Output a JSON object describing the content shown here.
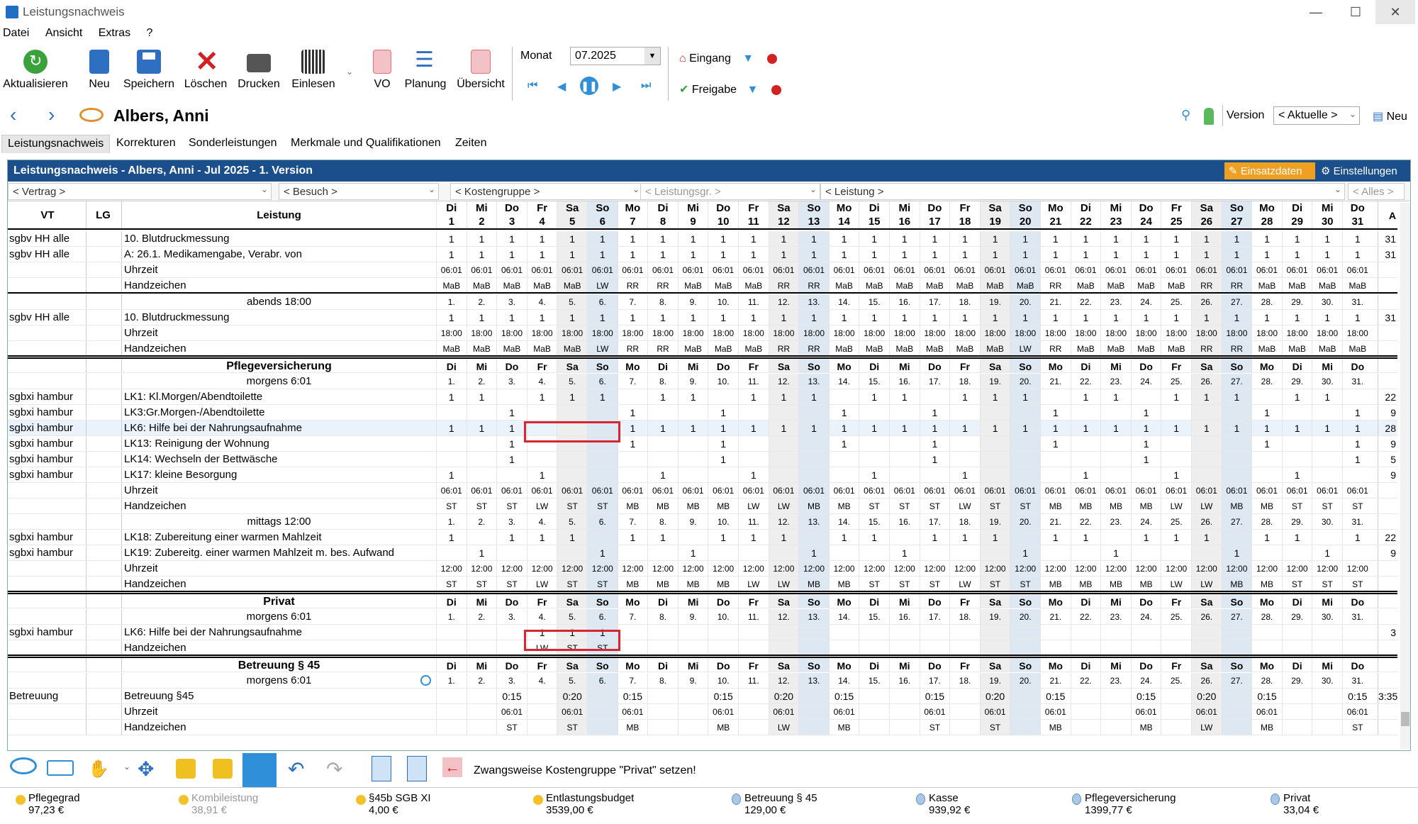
{
  "window": {
    "title": "Leistungsnachweis",
    "controls": [
      "—",
      "☐",
      "✕"
    ]
  },
  "menu": [
    "Datei",
    "Ansicht",
    "Extras",
    "?"
  ],
  "toolbar": {
    "buttons": [
      {
        "label": "Aktualisieren",
        "icon": "refresh-icon",
        "color": "#3aa23a"
      },
      {
        "label": "Neu",
        "icon": "new-document-icon",
        "color": "#2f6fc1"
      },
      {
        "label": "Speichern",
        "icon": "save-icon",
        "color": "#2f6fc1"
      },
      {
        "label": "Löschen",
        "icon": "delete-icon",
        "color": "#d32020"
      },
      {
        "label": "Drucken",
        "icon": "print-icon",
        "color": "#444444"
      },
      {
        "label": "Einlesen",
        "icon": "barcode-icon",
        "color": "#333333"
      },
      {
        "label": "VO",
        "icon": "prescription-icon",
        "color": "#e0707a"
      },
      {
        "label": "Planung",
        "icon": "planning-list-icon",
        "color": "#2f6fc1"
      },
      {
        "label": "Übersicht",
        "icon": "overview-icon",
        "color": "#e0707a"
      }
    ],
    "monat_label": "Monat",
    "monat_value": "07.2025",
    "eingang_label": "Eingang",
    "freigabe_label": "Freigabe"
  },
  "nav": {
    "patient_name": "Albers, Anni",
    "version_label": "Version",
    "version_value": "< Aktuelle >",
    "neu_label": "Neu"
  },
  "tabs": [
    "Leistungsnachweis",
    "Korrekturen",
    "Sonderleistungen",
    "Merkmale und Qualifikationen",
    "Zeiten"
  ],
  "panel": {
    "title": "Leistungsnachweis - Albers, Anni - Jul 2025 - 1. Version",
    "einsatzdaten": "Einsatzdaten",
    "einstellungen": "Einstellungen"
  },
  "filters": [
    "< Vertrag >",
    "< Besuch >",
    "< Kostengruppe >",
    "< Leistungsgr. >",
    "< Leistung >",
    "< Alles >"
  ],
  "header": {
    "vt": "VT",
    "lg": "LG",
    "leistung": "Leistung",
    "a": "A",
    "weekdays": [
      "Di",
      "Mi",
      "Do",
      "Fr",
      "Sa",
      "So",
      "Mo",
      "Di",
      "Mi",
      "Do",
      "Fr",
      "Sa",
      "So",
      "Mo",
      "Di",
      "Mi",
      "Do",
      "Fr",
      "Sa",
      "So",
      "Mo",
      "Di",
      "Mi",
      "Do",
      "Fr",
      "Sa",
      "So",
      "Mo",
      "Di",
      "Mi",
      "Do"
    ],
    "days": [
      "1",
      "2",
      "3",
      "4",
      "5",
      "6",
      "7",
      "8",
      "9",
      "10",
      "11",
      "12",
      "13",
      "14",
      "15",
      "16",
      "17",
      "18",
      "19",
      "20",
      "21",
      "22",
      "23",
      "24",
      "25",
      "26",
      "27",
      "28",
      "29",
      "30",
      "31"
    ]
  },
  "rows": [
    {
      "vt": "sgbv HH alle",
      "ls": "10. Blutdruckmessung",
      "d": [
        "1",
        "1",
        "1",
        "1",
        "1",
        "1",
        "1",
        "1",
        "1",
        "1",
        "1",
        "1",
        "1",
        "1",
        "1",
        "1",
        "1",
        "1",
        "1",
        "1",
        "1",
        "1",
        "1",
        "1",
        "1",
        "1",
        "1",
        "1",
        "1",
        "1",
        "1"
      ],
      "a": "31"
    },
    {
      "vt": "sgbv HH alle",
      "ls": "A: 26.1. Medikamengabe, Verabr. von",
      "d": [
        "1",
        "1",
        "1",
        "1",
        "1",
        "1",
        "1",
        "1",
        "1",
        "1",
        "1",
        "1",
        "1",
        "1",
        "1",
        "1",
        "1",
        "1",
        "1",
        "1",
        "1",
        "1",
        "1",
        "1",
        "1",
        "1",
        "1",
        "1",
        "1",
        "1",
        "1"
      ],
      "a": "31"
    },
    {
      "ls": "Uhrzeit",
      "sz": "small",
      "d": [
        "06:01",
        "06:01",
        "06:01",
        "06:01",
        "06:01",
        "06:01",
        "06:01",
        "06:01",
        "06:01",
        "06:01",
        "06:01",
        "06:01",
        "06:01",
        "06:01",
        "06:01",
        "06:01",
        "06:01",
        "06:01",
        "06:01",
        "06:01",
        "06:01",
        "06:01",
        "06:01",
        "06:01",
        "06:01",
        "06:01",
        "06:01",
        "06:01",
        "06:01",
        "06:01",
        "06:01"
      ]
    },
    {
      "ls": "Handzeichen",
      "sz": "small",
      "thick": true,
      "d": [
        "MaB",
        "MaB",
        "MaB",
        "MaB",
        "MaB",
        "LW",
        "RR",
        "RR",
        "MaB",
        "MaB",
        "MaB",
        "RR",
        "RR",
        "MaB",
        "MaB",
        "MaB",
        "MaB",
        "MaB",
        "MaB",
        "MaB",
        "RR",
        "MaB",
        "MaB",
        "MaB",
        "MaB",
        "RR",
        "RR",
        "MaB",
        "MaB",
        "MaB",
        "MaB"
      ]
    },
    {
      "ls": "abends 18:00",
      "ctr": true,
      "sz": "small",
      "d": [
        "1.",
        "2.",
        "3.",
        "4.",
        "5.",
        "6.",
        "7.",
        "8.",
        "9.",
        "10.",
        "11.",
        "12.",
        "13.",
        "14.",
        "15.",
        "16.",
        "17.",
        "18.",
        "19.",
        "20.",
        "21.",
        "22.",
        "23.",
        "24.",
        "25.",
        "26.",
        "27.",
        "28.",
        "29.",
        "30.",
        "31."
      ]
    },
    {
      "vt": "sgbv HH alle",
      "ls": "10. Blutdruckmessung",
      "d": [
        "1",
        "1",
        "1",
        "1",
        "1",
        "1",
        "1",
        "1",
        "1",
        "1",
        "1",
        "1",
        "1",
        "1",
        "1",
        "1",
        "1",
        "1",
        "1",
        "1",
        "1",
        "1",
        "1",
        "1",
        "1",
        "1",
        "1",
        "1",
        "1",
        "1",
        "1"
      ],
      "a": "31"
    },
    {
      "ls": "Uhrzeit",
      "sz": "small",
      "d": [
        "18:00",
        "18:00",
        "18:00",
        "18:00",
        "18:00",
        "18:00",
        "18:00",
        "18:00",
        "18:00",
        "18:00",
        "18:00",
        "18:00",
        "18:00",
        "18:00",
        "18:00",
        "18:00",
        "18:00",
        "18:00",
        "18:00",
        "18:00",
        "18:00",
        "18:00",
        "18:00",
        "18:00",
        "18:00",
        "18:00",
        "18:00",
        "18:00",
        "18:00",
        "18:00",
        "18:00"
      ]
    },
    {
      "ls": "Handzeichen",
      "sz": "small",
      "thick": true,
      "d": [
        "MaB",
        "MaB",
        "MaB",
        "MaB",
        "MaB",
        "LW",
        "RR",
        "RR",
        "MaB",
        "MaB",
        "MaB",
        "RR",
        "RR",
        "MaB",
        "MaB",
        "MaB",
        "MaB",
        "MaB",
        "MaB",
        "LW",
        "RR",
        "MaB",
        "MaB",
        "MaB",
        "MaB",
        "RR",
        "RR",
        "MaB",
        "MaB",
        "MaB",
        "MaB"
      ]
    },
    {
      "ls": "Pflegeversicherung",
      "ctr": true,
      "bold": true,
      "wk": true
    },
    {
      "ls": "morgens 6:01",
      "ctr": true,
      "sz": "small",
      "d": [
        "1.",
        "2.",
        "3.",
        "4.",
        "5.",
        "6.",
        "7.",
        "8.",
        "9.",
        "10.",
        "11.",
        "12.",
        "13.",
        "14.",
        "15.",
        "16.",
        "17.",
        "18.",
        "19.",
        "20.",
        "21.",
        "22.",
        "23.",
        "24.",
        "25.",
        "26.",
        "27.",
        "28.",
        "29.",
        "30.",
        "31."
      ]
    },
    {
      "vt": "sgbxi hambur",
      "ls": "LK1: Kl.Morgen/Abendtoilette",
      "d": [
        "1",
        "1",
        "",
        "1",
        "1",
        "1",
        "",
        "1",
        "1",
        "",
        "1",
        "1",
        "1",
        "",
        "1",
        "1",
        "",
        "1",
        "1",
        "1",
        "",
        "1",
        "1",
        "",
        "1",
        "1",
        "1",
        "",
        "1",
        "1",
        ""
      ],
      "a": "22"
    },
    {
      "vt": "sgbxi hambur",
      "ls": "LK3:Gr.Morgen-/Abendtoilette",
      "d": [
        "",
        "",
        "1",
        "",
        "",
        "",
        "1",
        "",
        "",
        "1",
        "",
        "",
        "",
        "1",
        "",
        "",
        "1",
        "",
        "",
        "",
        "1",
        "",
        "",
        "1",
        "",
        "",
        "",
        "1",
        "",
        "",
        "1"
      ],
      "a": "9"
    },
    {
      "vt": "sgbxi hambur",
      "ls": "LK6: Hilfe bei der Nahrungsaufnahme",
      "sel": true,
      "d": [
        "1",
        "1",
        "1",
        "",
        "",
        "",
        "1",
        "1",
        "1",
        "1",
        "1",
        "1",
        "1",
        "1",
        "1",
        "1",
        "1",
        "1",
        "1",
        "1",
        "1",
        "1",
        "1",
        "1",
        "1",
        "1",
        "1",
        "1",
        "1",
        "1",
        "1"
      ],
      "a": "28"
    },
    {
      "vt": "sgbxi hambur",
      "ls": "LK13: Reinigung der Wohnung",
      "d": [
        "",
        "",
        "1",
        "",
        "",
        "",
        "1",
        "",
        "",
        "1",
        "",
        "",
        "",
        "1",
        "",
        "",
        "1",
        "",
        "",
        "",
        "1",
        "",
        "",
        "1",
        "",
        "",
        "",
        "1",
        "",
        "",
        "1"
      ],
      "a": "9"
    },
    {
      "vt": "sgbxi hambur",
      "ls": "LK14: Wechseln der Bettwäsche",
      "d": [
        "",
        "",
        "1",
        "",
        "",
        "",
        "",
        "",
        "",
        "1",
        "",
        "",
        "",
        "",
        "",
        "",
        "1",
        "",
        "",
        "",
        "",
        "",
        "",
        "1",
        "",
        "",
        "",
        "",
        "",
        "",
        "1"
      ],
      "a": "5"
    },
    {
      "vt": "sgbxi hambur",
      "ls": "LK17: kleine Besorgung",
      "d": [
        "1",
        "",
        "",
        "1",
        "",
        "",
        "",
        "1",
        "",
        "",
        "1",
        "",
        "",
        "",
        "1",
        "",
        "",
        "1",
        "",
        "",
        "",
        "1",
        "",
        "",
        "1",
        "",
        "",
        "",
        "1",
        "",
        ""
      ],
      "a": "9"
    },
    {
      "ls": "Uhrzeit",
      "sz": "small",
      "d": [
        "06:01",
        "06:01",
        "06:01",
        "06:01",
        "06:01",
        "06:01",
        "06:01",
        "06:01",
        "06:01",
        "06:01",
        "06:01",
        "06:01",
        "06:01",
        "06:01",
        "06:01",
        "06:01",
        "06:01",
        "06:01",
        "06:01",
        "06:01",
        "06:01",
        "06:01",
        "06:01",
        "06:01",
        "06:01",
        "06:01",
        "06:01",
        "06:01",
        "06:01",
        "06:01",
        "06:01"
      ]
    },
    {
      "ls": "Handzeichen",
      "sz": "small",
      "d": [
        "ST",
        "ST",
        "ST",
        "LW",
        "ST",
        "ST",
        "MB",
        "MB",
        "MB",
        "MB",
        "LW",
        "LW",
        "MB",
        "MB",
        "ST",
        "ST",
        "ST",
        "LW",
        "ST",
        "ST",
        "MB",
        "MB",
        "MB",
        "MB",
        "LW",
        "LW",
        "MB",
        "MB",
        "ST",
        "ST",
        "ST"
      ]
    },
    {
      "ls": "mittags 12:00",
      "ctr": true,
      "sz": "small",
      "d": [
        "1.",
        "2.",
        "3.",
        "4.",
        "5.",
        "6.",
        "7.",
        "8.",
        "9.",
        "10.",
        "11.",
        "12.",
        "13.",
        "14.",
        "15.",
        "16.",
        "17.",
        "18.",
        "19.",
        "20.",
        "21.",
        "22.",
        "23.",
        "24.",
        "25.",
        "26.",
        "27.",
        "28.",
        "29.",
        "30.",
        "31."
      ]
    },
    {
      "vt": "sgbxi hambur",
      "ls": "LK18: Zubereitung einer warmen Mahlzeit",
      "d": [
        "1",
        "",
        "1",
        "1",
        "1",
        "",
        "1",
        "1",
        "",
        "1",
        "1",
        "1",
        "",
        "1",
        "1",
        "",
        "1",
        "1",
        "1",
        "",
        "1",
        "1",
        "",
        "1",
        "1",
        "1",
        "",
        "1",
        "1",
        "",
        "1"
      ],
      "a": "22"
    },
    {
      "vt": "sgbxi hambur",
      "ls": "LK19: Zubereitg. einer warmen Mahlzeit m. bes. Aufwand",
      "d": [
        "",
        "1",
        "",
        "",
        "",
        "1",
        "",
        "",
        "1",
        "",
        "",
        "",
        "1",
        "",
        "",
        "1",
        "",
        "",
        "",
        "1",
        "",
        "",
        "1",
        "",
        "",
        "",
        "1",
        "",
        "",
        "1",
        ""
      ],
      "a": "9"
    },
    {
      "ls": "Uhrzeit",
      "sz": "small",
      "d": [
        "12:00",
        "12:00",
        "12:00",
        "12:00",
        "12:00",
        "12:00",
        "12:00",
        "12:00",
        "12:00",
        "12:00",
        "12:00",
        "12:00",
        "12:00",
        "12:00",
        "12:00",
        "12:00",
        "12:00",
        "12:00",
        "12:00",
        "12:00",
        "12:00",
        "12:00",
        "12:00",
        "12:00",
        "12:00",
        "12:00",
        "12:00",
        "12:00",
        "12:00",
        "12:00",
        "12:00"
      ]
    },
    {
      "ls": "Handzeichen",
      "sz": "small",
      "thick": true,
      "d": [
        "ST",
        "ST",
        "ST",
        "LW",
        "ST",
        "ST",
        "MB",
        "MB",
        "MB",
        "MB",
        "LW",
        "LW",
        "MB",
        "MB",
        "ST",
        "ST",
        "ST",
        "LW",
        "ST",
        "ST",
        "MB",
        "MB",
        "MB",
        "MB",
        "LW",
        "LW",
        "MB",
        "MB",
        "ST",
        "ST",
        "ST"
      ]
    },
    {
      "ls": "Privat",
      "ctr": true,
      "bold": true,
      "wk": true
    },
    {
      "ls": "morgens 6:01",
      "ctr": true,
      "sz": "small",
      "d": [
        "1.",
        "2.",
        "3.",
        "4.",
        "5.",
        "6.",
        "7.",
        "8.",
        "9.",
        "10.",
        "11.",
        "12.",
        "13.",
        "14.",
        "15.",
        "16.",
        "17.",
        "18.",
        "19.",
        "20.",
        "21.",
        "22.",
        "23.",
        "24.",
        "25.",
        "26.",
        "27.",
        "28.",
        "29.",
        "30.",
        "31."
      ]
    },
    {
      "vt": "sgbxi hambur",
      "ls": "LK6: Hilfe bei der Nahrungsaufnahme",
      "d": [
        "",
        "",
        "",
        "1",
        "1",
        "1",
        "",
        "",
        "",
        "",
        "",
        "",
        "",
        "",
        "",
        "",
        "",
        "",
        "",
        "",
        "",
        "",
        "",
        "",
        "",
        "",
        "",
        "",
        "",
        "",
        ""
      ],
      "a": "3"
    },
    {
      "ls": "Handzeichen",
      "sz": "small",
      "thick": true,
      "d": [
        "",
        "",
        "",
        "LW",
        "ST",
        "ST",
        "",
        "",
        "",
        "",
        "",
        "",
        "",
        "",
        "",
        "",
        "",
        "",
        "",
        "",
        "",
        "",
        "",
        "",
        "",
        "",
        "",
        "",
        "",
        "",
        ""
      ]
    },
    {
      "ls": "Betreuung § 45",
      "ctr": true,
      "bold": true,
      "wk": true
    },
    {
      "ls": "morgens 6:01",
      "ctr": true,
      "sz": "small",
      "d": [
        "1.",
        "2.",
        "3.",
        "4.",
        "5.",
        "6.",
        "7.",
        "8.",
        "9.",
        "10.",
        "11.",
        "12.",
        "13.",
        "14.",
        "15.",
        "16.",
        "17.",
        "18.",
        "19.",
        "20.",
        "21.",
        "22.",
        "23.",
        "24.",
        "25.",
        "26.",
        "27.",
        "28.",
        "29.",
        "30.",
        "31."
      ]
    },
    {
      "vt": "Betreuung",
      "ls": "Betreuung §45",
      "d": [
        "",
        "",
        "0:15",
        "",
        "0:20",
        "",
        "0:15",
        "",
        "",
        "0:15",
        "",
        "0:20",
        "",
        "0:15",
        "",
        "",
        "0:15",
        "",
        "0:20",
        "",
        "0:15",
        "",
        "",
        "0:15",
        "",
        "0:20",
        "",
        "0:15",
        "",
        "",
        "0:15"
      ],
      "a": "3:35"
    },
    {
      "ls": "Uhrzeit",
      "sz": "small",
      "d": [
        "",
        "",
        "06:01",
        "",
        "06:01",
        "",
        "06:01",
        "",
        "",
        "06:01",
        "",
        "06:01",
        "",
        "06:01",
        "",
        "",
        "06:01",
        "",
        "06:01",
        "",
        "06:01",
        "",
        "",
        "06:01",
        "",
        "06:01",
        "",
        "06:01",
        "",
        "",
        "06:01"
      ]
    },
    {
      "ls": "Handzeichen",
      "sz": "small",
      "d": [
        "",
        "",
        "ST",
        "",
        "ST",
        "",
        "MB",
        "",
        "",
        "MB",
        "",
        "LW",
        "",
        "MB",
        "",
        "",
        "ST",
        "",
        "ST",
        "",
        "MB",
        "",
        "",
        "MB",
        "",
        "LW",
        "",
        "MB",
        "",
        "",
        "ST"
      ]
    }
  ],
  "bottom_hint": "Zwangsweise Kostengruppe \"Privat\" setzen!",
  "status": [
    {
      "label": "Pflegegrad",
      "value": "97,23 €",
      "kind": "coin"
    },
    {
      "label": "Kombileistung",
      "value": "38,91 €",
      "kind": "coin",
      "disabled": true
    },
    {
      "label": "§45b SGB XI",
      "value": "4,00 €",
      "kind": "coin"
    },
    {
      "label": "Entlastungsbudget",
      "value": "3539,00 €",
      "kind": "coin"
    },
    {
      "label": "Betreuung § 45",
      "value": "129,00 €",
      "kind": "drop"
    },
    {
      "label": "Kasse",
      "value": "939,92 €",
      "kind": "drop"
    },
    {
      "label": "Pflegeversicherung",
      "value": "1399,77 €",
      "kind": "drop"
    },
    {
      "label": "Privat",
      "value": "33,04 €",
      "kind": "drop"
    }
  ],
  "colors": {
    "header_bar": "#1a4f8c",
    "highlight": "#d6262f",
    "sunday_col": "#dde8f2",
    "accent_orange": "#f0a020"
  }
}
